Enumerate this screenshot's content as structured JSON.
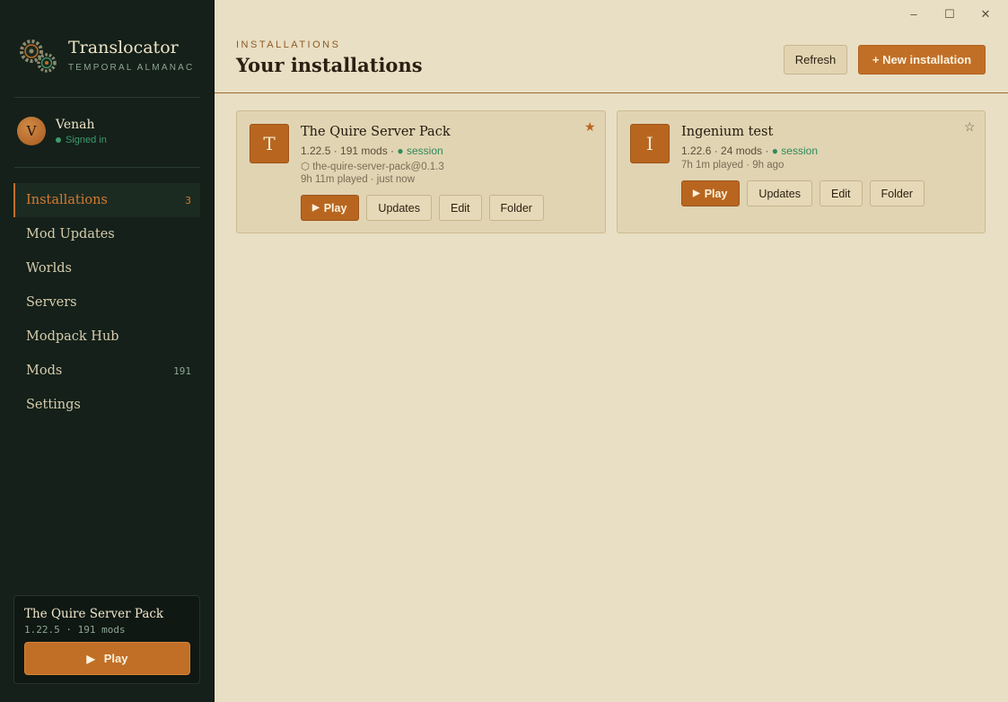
{
  "app": {
    "title": "Translocator",
    "subtitle": "TEMPORAL ALMANAC"
  },
  "user": {
    "initial": "V",
    "name": "Venah",
    "status": "Signed in"
  },
  "nav": {
    "items": [
      {
        "label": "Installations",
        "count": "3",
        "active": true
      },
      {
        "label": "Mod Updates",
        "count": ""
      },
      {
        "label": "Worlds",
        "count": ""
      },
      {
        "label": "Servers",
        "count": ""
      },
      {
        "label": "Modpack Hub",
        "count": ""
      },
      {
        "label": "Mods",
        "count": "191"
      },
      {
        "label": "Settings",
        "count": ""
      }
    ]
  },
  "quick_launch": {
    "name": "The Quire Server Pack",
    "details": "1.22.5 · 191 mods",
    "play_label": "Play"
  },
  "window_controls": {
    "minimize": "–",
    "maximize": "☐",
    "close": "✕"
  },
  "header": {
    "eyebrow": "INSTALLATIONS",
    "title": "Your installations",
    "refresh_label": "Refresh",
    "new_label": "+ New installation"
  },
  "installations": [
    {
      "initial": "T",
      "name": "The Quire Server Pack",
      "meta": "1.22.5 · 191 mods · ",
      "session": "● session",
      "pack": "⬡ the-quire-server-pack@0.1.3",
      "played": "9h 11m played · just now",
      "favorite": true,
      "star": "★"
    },
    {
      "initial": "I",
      "name": "Ingenium test",
      "meta": "1.22.6 · 24 mods · ",
      "session": "● session",
      "played": "7h 1m played · 9h ago",
      "favorite": false,
      "star": "☆"
    }
  ],
  "card_actions": {
    "play": "Play",
    "updates": "Updates",
    "edit": "Edit",
    "folder": "Folder"
  },
  "colors": {
    "accent": "#c16f27",
    "sidebar_bg": "#142019",
    "content_bg": "#e9dfc4",
    "card_bg": "#e1d4b2",
    "online": "#3f9a6d"
  }
}
